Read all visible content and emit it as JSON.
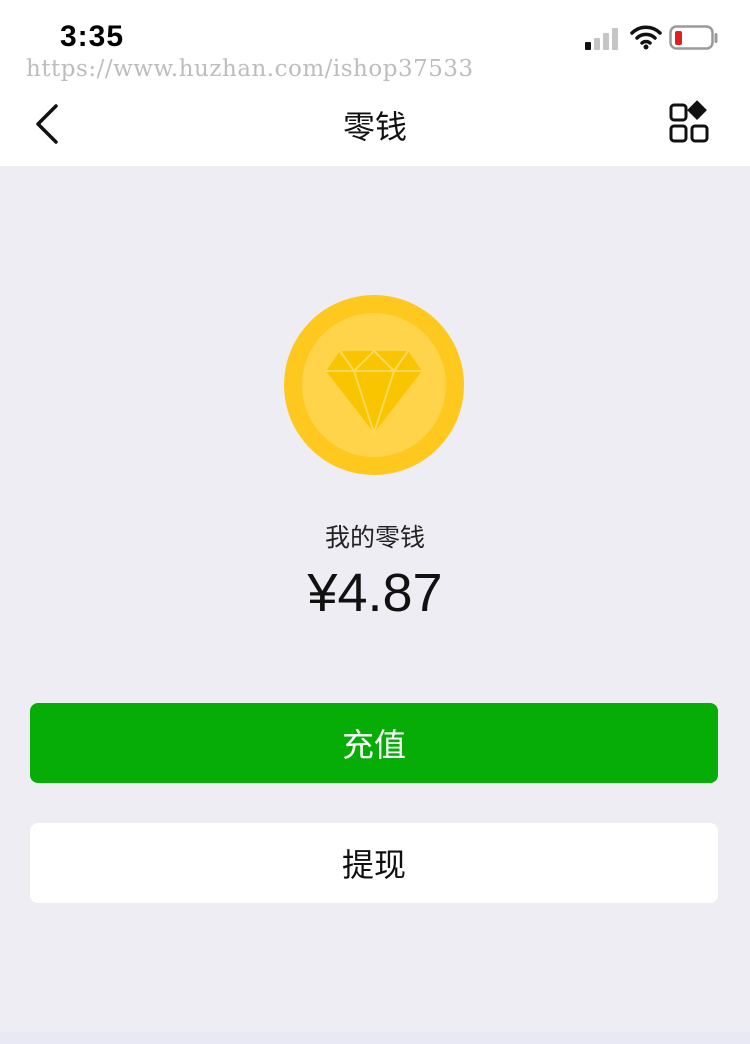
{
  "status_bar": {
    "time": "3:35",
    "watermark": "https://www.huzhan.com/ishop37533",
    "signal_icon": "cellular-signal-icon",
    "wifi_icon": "wifi-icon",
    "battery_icon": "battery-low-icon"
  },
  "nav": {
    "back_icon": "chevron-left-icon",
    "title": "零钱",
    "menu_icon": "grid-menu-icon"
  },
  "wallet": {
    "coin_icon": "diamond-coin-icon",
    "label": "我的零钱",
    "amount": "¥4.87"
  },
  "actions": {
    "recharge_label": "充值",
    "withdraw_label": "提现"
  },
  "colors": {
    "accent_green": "#06ad06",
    "coin_outer": "#ffc81e",
    "coin_inner": "#ffd44a",
    "diamond": "#f9c400",
    "background": "#efedf4",
    "battery_low": "#e02020"
  }
}
